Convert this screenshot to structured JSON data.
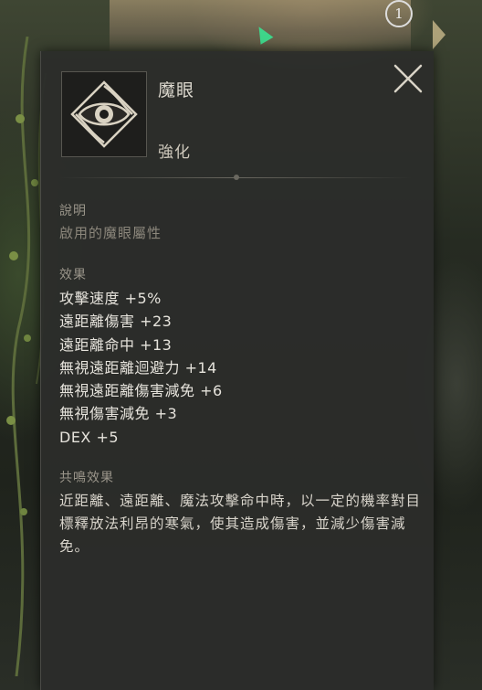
{
  "map": {
    "badge": "1"
  },
  "tooltip": {
    "item_name": "魔眼",
    "item_type": "強化",
    "icon": "eye-emblem-icon",
    "description": {
      "title": "說明",
      "text": "啟用的魔眼屬性"
    },
    "effects": {
      "title": "效果",
      "items": [
        "攻擊速度 +5%",
        "遠距離傷害 +23",
        "遠距離命中 +13",
        "無視遠距離迴避力 +14",
        "無視遠距離傷害減免 +6",
        "無視傷害減免 +3",
        "DEX +5"
      ]
    },
    "resonance": {
      "title": "共鳴效果",
      "text": "近距離、遠距離、魔法攻擊命中時，以一定的機率對目標釋放法利昂的寒氣，使其造成傷害，並減少傷害減免。"
    }
  },
  "colors": {
    "panel_bg": "#2c2d2b",
    "text_primary": "#e6e3dc",
    "text_muted": "#9a958a",
    "map_marker": "#3fd58a"
  }
}
